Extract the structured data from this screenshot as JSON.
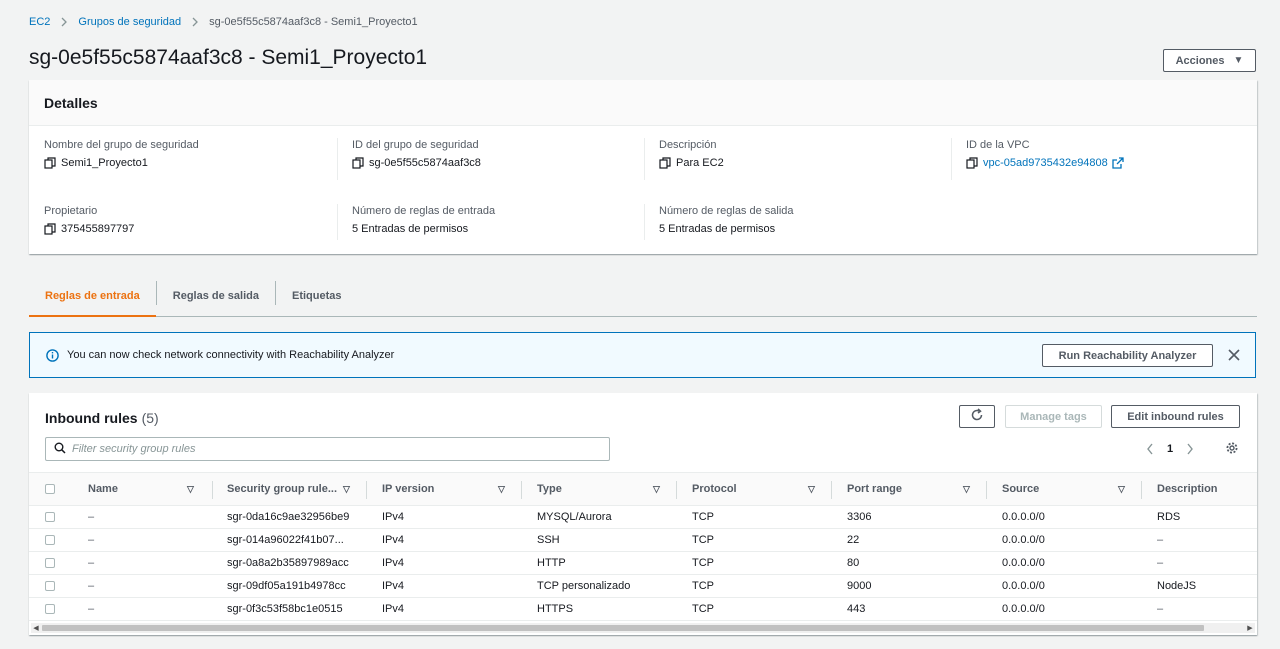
{
  "breadcrumb": {
    "item1": "EC2",
    "item2": "Grupos de seguridad",
    "current": "sg-0e5f55c5874aaf3c8 - Semi1_Proyecto1"
  },
  "title": "sg-0e5f55c5874aaf3c8 - Semi1_Proyecto1",
  "actions_label": "Acciones",
  "details": {
    "header": "Detalles",
    "sg_name_label": "Nombre del grupo de seguridad",
    "sg_name": "Semi1_Proyecto1",
    "sg_id_label": "ID del grupo de seguridad",
    "sg_id": "sg-0e5f55c5874aaf3c8",
    "description_label": "Descripción",
    "description": "Para EC2",
    "vpc_label": "ID de la VPC",
    "vpc_id": "vpc-05ad9735432e94808",
    "owner_label": "Propietario",
    "owner": "375455897797",
    "inbound_count_label": "Número de reglas de entrada",
    "inbound_count": "5 Entradas de permisos",
    "outbound_count_label": "Número de reglas de salida",
    "outbound_count": "5 Entradas de permisos"
  },
  "tabs": [
    "Reglas de entrada",
    "Reglas de salida",
    "Etiquetas"
  ],
  "banner": {
    "text": "You can now check network connectivity with Reachability Analyzer",
    "button": "Run Reachability Analyzer"
  },
  "rules": {
    "title": "Inbound rules",
    "count": "(5)",
    "manage_tags": "Manage tags",
    "edit": "Edit inbound rules",
    "filter_placeholder": "Filter security group rules",
    "page": "1",
    "columns": [
      "Name",
      "Security group rule...",
      "IP version",
      "Type",
      "Protocol",
      "Port range",
      "Source",
      "Description"
    ],
    "rows": [
      [
        "–",
        "sgr-0da16c9ae32956be9",
        "IPv4",
        "MYSQL/Aurora",
        "TCP",
        "3306",
        "0.0.0.0/0",
        "RDS"
      ],
      [
        "–",
        "sgr-014a96022f41b07...",
        "IPv4",
        "SSH",
        "TCP",
        "22",
        "0.0.0.0/0",
        "–"
      ],
      [
        "–",
        "sgr-0a8a2b35897989acc",
        "IPv4",
        "HTTP",
        "TCP",
        "80",
        "0.0.0.0/0",
        "–"
      ],
      [
        "–",
        "sgr-09df05a191b4978cc",
        "IPv4",
        "TCP personalizado",
        "TCP",
        "9000",
        "0.0.0.0/0",
        "NodeJS"
      ],
      [
        "–",
        "sgr-0f3c53f58bc1e0515",
        "IPv4",
        "HTTPS",
        "TCP",
        "443",
        "0.0.0.0/0",
        "–"
      ]
    ]
  },
  "colors": {
    "link": "#0073bb",
    "accent": "#ec7211",
    "info_bg": "#f1faff"
  }
}
